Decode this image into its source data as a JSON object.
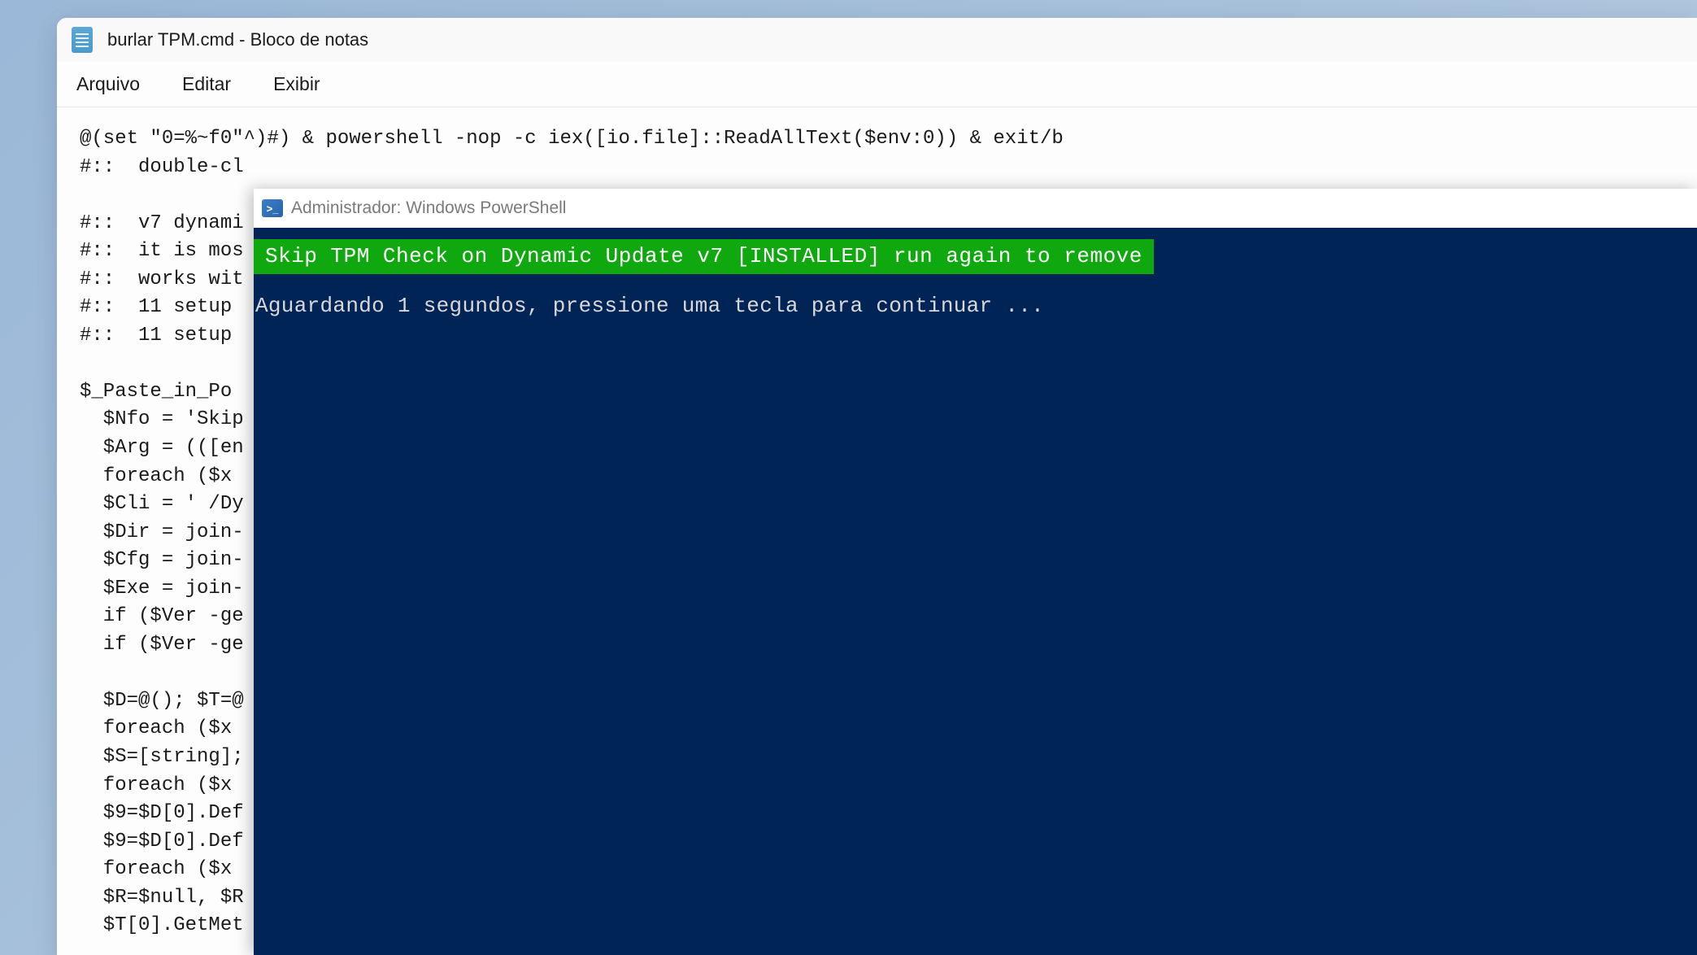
{
  "notepad": {
    "title": "burlar TPM.cmd - Bloco de notas",
    "menu": {
      "file": "Arquivo",
      "edit": "Editar",
      "view": "Exibir"
    },
    "lines": {
      "l1": "@(set \"0=%~f0\"^)#) & powershell -nop -c iex([io.file]::ReadAllText($env:0)) & exit/b",
      "l2": "#::  double-cl",
      "l3": "",
      "l4": "#::  v7 dynami",
      "l5": "#::  it is mos",
      "l6": "#::  works wit",
      "l7": "#::  11 setup",
      "l8": "#::  11 setup",
      "l9": "",
      "l10": "$_Paste_in_Po",
      "l11": "  $Nfo = 'Skip",
      "l12": "  $Arg = (([en",
      "l13": "  foreach ($x",
      "l14": "  $Cli = ' /Dy",
      "l15": "  $Dir = join-",
      "l16": "  $Cfg = join-",
      "l17": "  $Exe = join-",
      "l18": "  if ($Ver -ge",
      "l19": "  if ($Ver -ge",
      "l20": "",
      "l21": "  $D=@(); $T=@",
      "l22": "  foreach ($x",
      "l23": "  $S=[string];",
      "l24": "  foreach ($x",
      "l25": "  $9=$D[0].Def",
      "l26": "  $9=$D[0].Def",
      "l27": "  foreach ($x",
      "l28": "  $R=$null, $R",
      "l29": "  $T[0].GetMet"
    }
  },
  "powershell": {
    "title": "Administrador: Windows PowerShell",
    "line_green": " Skip TPM Check on Dynamic Update v7 [INSTALLED] run again to remove ",
    "line_wait": "Aguardando 1 segundos, pressione uma tecla para continuar ..."
  }
}
